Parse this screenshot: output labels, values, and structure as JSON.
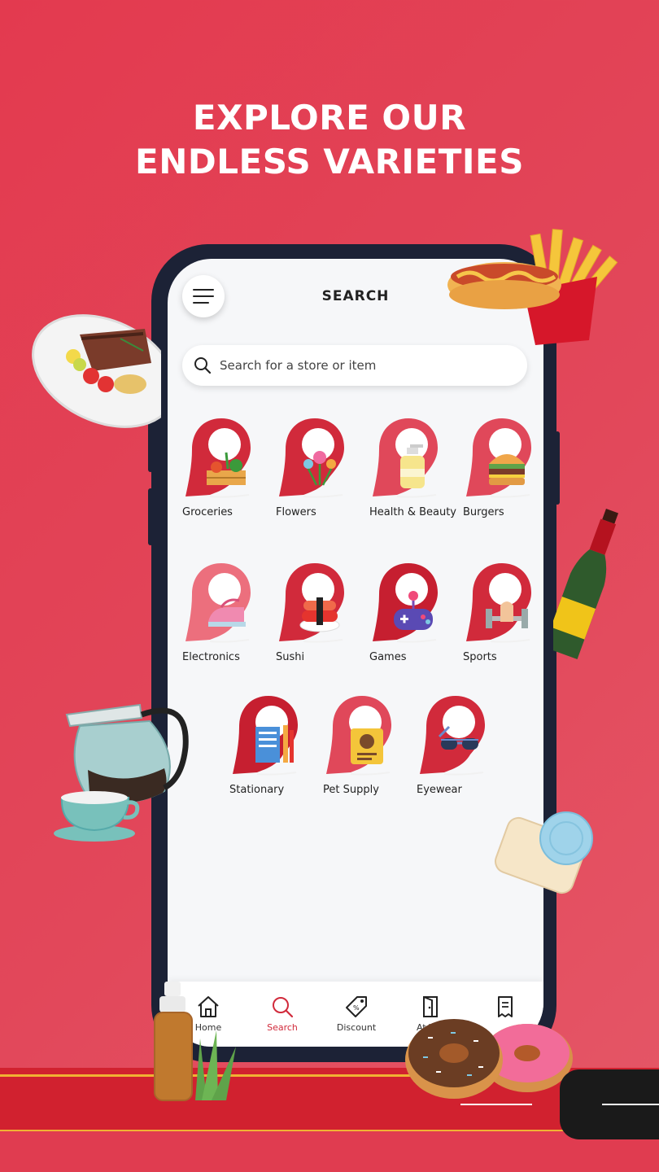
{
  "headline": {
    "line1": "EXPLORE OUR",
    "line2": "ENDLESS VARIETIES"
  },
  "screen": {
    "title": "SEARCH",
    "search_placeholder": "Search for a store or item"
  },
  "categories": [
    {
      "label": "Groceries",
      "icon": "groceries-icon"
    },
    {
      "label": "Flowers",
      "icon": "flowers-icon"
    },
    {
      "label": "Health & Beauty",
      "icon": "health-beauty-icon"
    },
    {
      "label": "Burgers",
      "icon": "burger-icon"
    },
    {
      "label": "Electronics",
      "icon": "iron-icon"
    },
    {
      "label": "Sushi",
      "icon": "sushi-icon"
    },
    {
      "label": "Games",
      "icon": "gamepad-icon"
    },
    {
      "label": "Sports",
      "icon": "dumbbell-icon"
    },
    {
      "label": "Stationary",
      "icon": "notebook-icon"
    },
    {
      "label": "Pet Supply",
      "icon": "pet-food-icon"
    },
    {
      "label": "Eyewear",
      "icon": "sunglasses-icon"
    }
  ],
  "bottom_nav": [
    {
      "label": "Home",
      "icon": "home-icon"
    },
    {
      "label": "Search",
      "icon": "search-icon",
      "active": true
    },
    {
      "label": "Discount",
      "icon": "tag-icon"
    },
    {
      "label": "At You",
      "icon": "door-icon"
    },
    {
      "label": "",
      "icon": "receipt-icon"
    }
  ],
  "colors": {
    "background": "#e33a4f",
    "accent": "#d12a3b",
    "phone": "#1c2236"
  }
}
